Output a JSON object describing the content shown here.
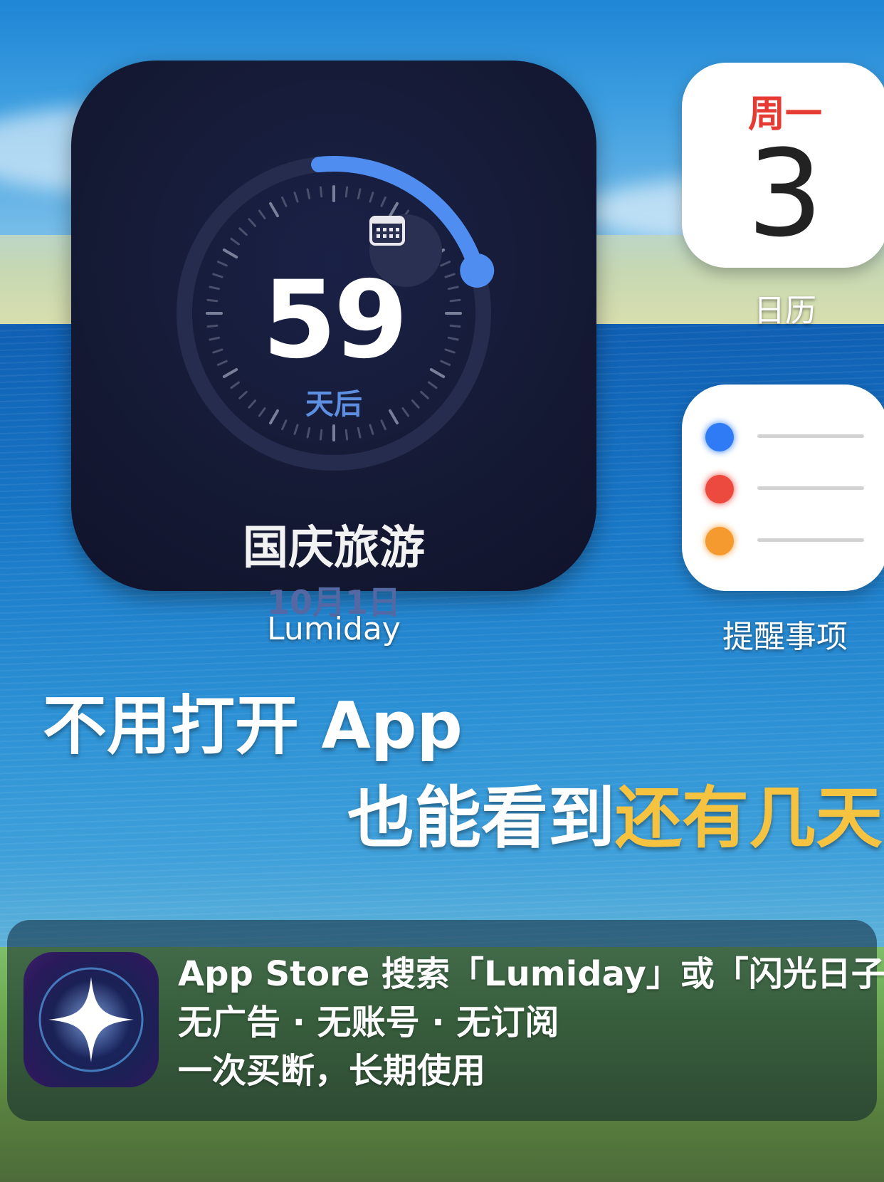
{
  "countdown_widget": {
    "days": "59",
    "days_suffix": "天后",
    "event_title": "国庆旅游",
    "event_date": "10月1日",
    "app_label": "Lumiday",
    "progress_fraction": 0.18,
    "accent_color": "#4f8ef0"
  },
  "calendar_icon": {
    "weekday": "周一",
    "day": "3",
    "label": "日历",
    "weekday_color": "#e63b32"
  },
  "reminders_icon": {
    "label": "提醒事项",
    "dot_colors": [
      "#2f7bf5",
      "#ec4a3f",
      "#f59a2e"
    ]
  },
  "headline": {
    "line1": "不用打开 App",
    "line2_prefix": "也能看到",
    "line2_accent": "还有几天",
    "accent_color": "#f6c341"
  },
  "footer": {
    "icon": "sparkle-icon",
    "line1": "App Store 搜索「Lumiday」或「闪光日子」",
    "line2": "无广告 · 无账号 · 无订阅",
    "line3": "一次买断，长期使用"
  }
}
